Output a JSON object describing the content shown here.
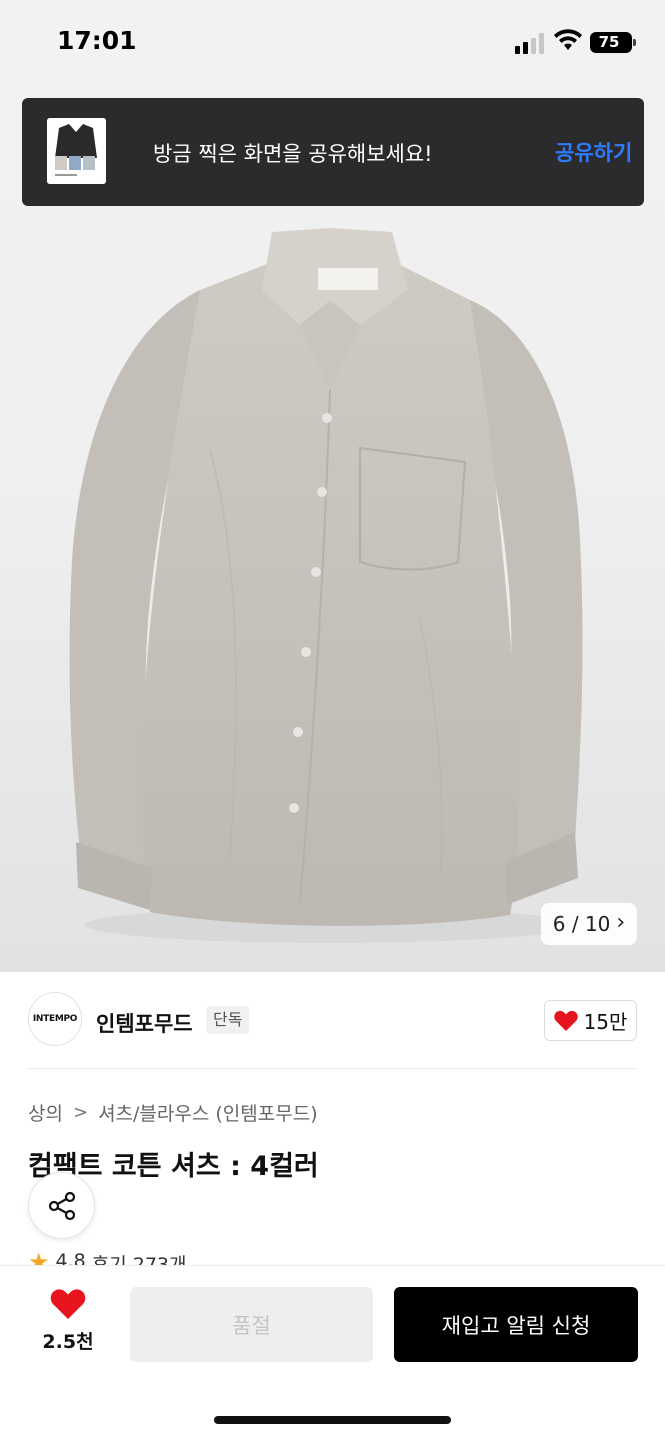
{
  "status_bar": {
    "time": "17:01",
    "battery": "75",
    "icons": [
      "signal-icon",
      "wifi-icon",
      "battery-icon"
    ]
  },
  "toast": {
    "message": "방금 찍은 화면을 공유해보세요!",
    "action": "공유하기",
    "action_color": "#2f7bff"
  },
  "gallery": {
    "current": "6 / 10",
    "chevron": "›"
  },
  "brand": {
    "logo_text": "INTEMPO",
    "name": "인템포무드",
    "badge": "단독"
  },
  "like": {
    "icon": "heart-icon",
    "count": "15만",
    "color": "#e8141d"
  },
  "breadcrumb": {
    "level1": "상의",
    "separator": ">",
    "level2": "셔츠/블라우스 (인템포무드)"
  },
  "product": {
    "title": "컴팩트 코튼 셔츠 : 4컬러"
  },
  "rating": {
    "score": "4.8",
    "reviews": "후기 273개"
  },
  "bottom_bar": {
    "wish_count": "2.5천",
    "soldout_label": "품절",
    "restock_label": "재입고 알림 신청"
  }
}
